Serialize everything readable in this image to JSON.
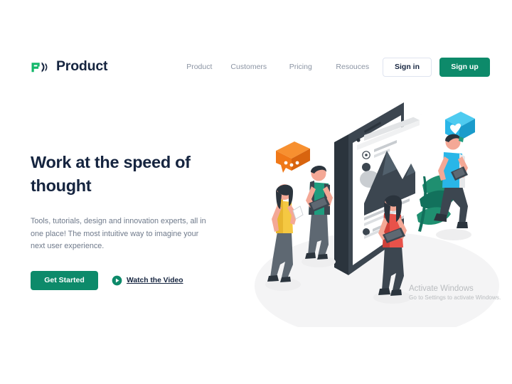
{
  "theme": {
    "brand_green": "#0d8a6a",
    "logo_green": "#12b76a",
    "navy": "#15243f",
    "body_gray": "#6f7a8b",
    "nav_gray": "#8b94a3",
    "border_gray": "#dfe4ef",
    "page_bg": "#ffffff",
    "illustration_dark": "#3c4650",
    "illustration_orange": "#f07818",
    "illustration_blue": "#29b6e8",
    "illustration_red": "#e8524a",
    "illustration_yellow": "#f5c842",
    "illustration_teal": "#12715c",
    "illustration_skin": "#f4a896",
    "watermark_gray": "#b9bcbf"
  },
  "header": {
    "logo": {
      "icon": "product-logo-icon",
      "name": "Product"
    },
    "nav_items": [
      {
        "label": "Product"
      },
      {
        "label": "Customers"
      },
      {
        "label": "Pricing"
      },
      {
        "label": "Resouces"
      }
    ],
    "sign_in_label": "Sign in",
    "sign_up_label": "Sign up"
  },
  "hero": {
    "title": "Work at the speed of thought",
    "subtitle": "Tools, tutorials, design and innovation experts, all in one place! The most intuitive way to imagine your next user experience.",
    "primary_cta": "Get Started",
    "video_link_label": "Watch the Video",
    "play_icon": "play-circle-icon",
    "illustration": {
      "name": "isometric-social-media-illustration",
      "elements": [
        "large-smartphone-with-social-post",
        "social-post-card",
        "mountain-photo-placeholder",
        "orange-chat-bubble-icon",
        "blue-heart-like-bubble-icon",
        "green-plant-leaves",
        "person-woman-yellow-top-with-phone",
        "person-man-teal-shirt-with-tablet",
        "person-woman-red-top-with-tablet",
        "person-man-blue-shirt-walking-with-tablet"
      ]
    }
  },
  "watermark": {
    "title": "Activate Windows",
    "subtitle": "Go to Settings to activate Windows."
  }
}
